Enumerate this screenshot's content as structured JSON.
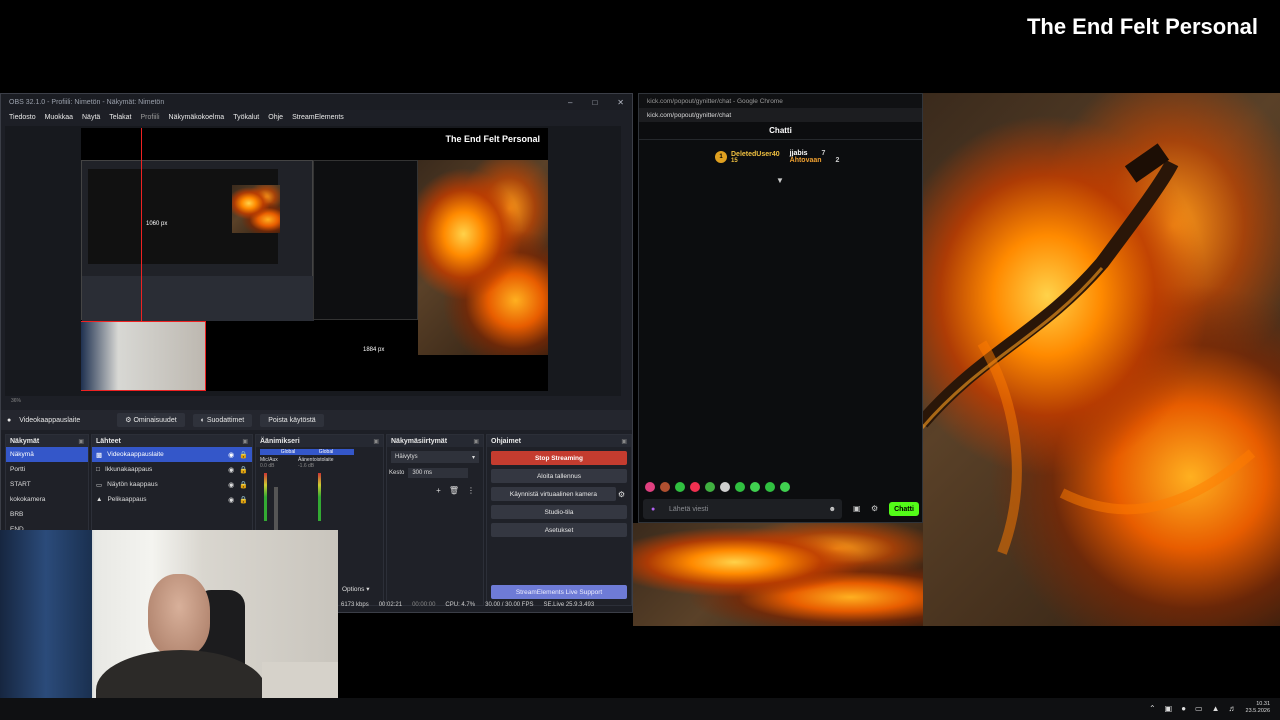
{
  "headline": "The End Felt Personal",
  "obs": {
    "title": "OBS 32.1.0 - Profiili: Nimetön - Näkymät: Nimetön",
    "menu": [
      "Tiedosto",
      "Muokkaa",
      "Näytä",
      "Telakat",
      "Profiili",
      "Näkymäkokoelma",
      "Työkalut",
      "Ohje",
      "StreamElements"
    ],
    "canvas_title": "The End Felt Personal",
    "canvas_px_label_1": "1060 px",
    "canvas_px_label_2": "1884 px",
    "preview_zoom": "36%",
    "selected_source": "Videokaappauslaite",
    "source_buttons": [
      "Ominaisuudet",
      "Suodattimet",
      "Poista käytöstä"
    ],
    "docks": {
      "scenes": {
        "title": "Näkymät",
        "items": [
          "Näkymä",
          "Portti",
          "START",
          "kokokamera",
          "BRB",
          "END"
        ]
      },
      "sources": {
        "title": "Lähteet",
        "items": [
          "Videokaappauslaite",
          "Ikkunakaappaus",
          "Näytön kaappaus",
          "Pelikaappaus"
        ]
      },
      "mixer": {
        "title": "Äänimikseri",
        "ch1_label": "Global",
        "ch1_name": "Mic/Aux",
        "ch1_db": "0.0 dB",
        "ch2_label": "Global",
        "ch2_name": "Äänentoistolaite",
        "ch2_db": "-1.6 dB",
        "options": "Options"
      },
      "transitions": {
        "title": "Näkymäsiirtymät",
        "type": "Häivytys",
        "duration_label": "Kesto",
        "duration": "300 ms"
      },
      "controls": {
        "title": "Ohjaimet",
        "stop": "Stop Streaming",
        "record": "Aloita tallennus",
        "vcam": "Käynnistä virtuaalinen kamera",
        "studio": "Studio-tila",
        "settings": "Asetukset",
        "se_support": "StreamElements Live Support"
      }
    },
    "status": {
      "bitrate": "6173 kbps",
      "live_time": "00:02:21",
      "rec_time": "00:00:00",
      "cpu": "CPU: 4.7%",
      "fps": "30.00 / 30.00 FPS",
      "se": "SE.Live 25.9.3.493"
    }
  },
  "chat": {
    "window_title": "kick.com/popout/gynitter/chat - Google Chrome",
    "url": "kick.com/popout/gynitter/chat",
    "title": "Chatti",
    "gifters": [
      {
        "rank": "1",
        "name": "DeletedUser40",
        "count": "15"
      },
      {
        "rank": "",
        "name": "jjabis",
        "count": "7"
      },
      {
        "rank": "",
        "name": "Ahtovaan",
        "count": "2"
      }
    ],
    "input_placeholder": "Lähetä viesti",
    "send_label": "Chatti"
  },
  "taskbar": {
    "time": "10.31",
    "date": "23.5.2026"
  }
}
